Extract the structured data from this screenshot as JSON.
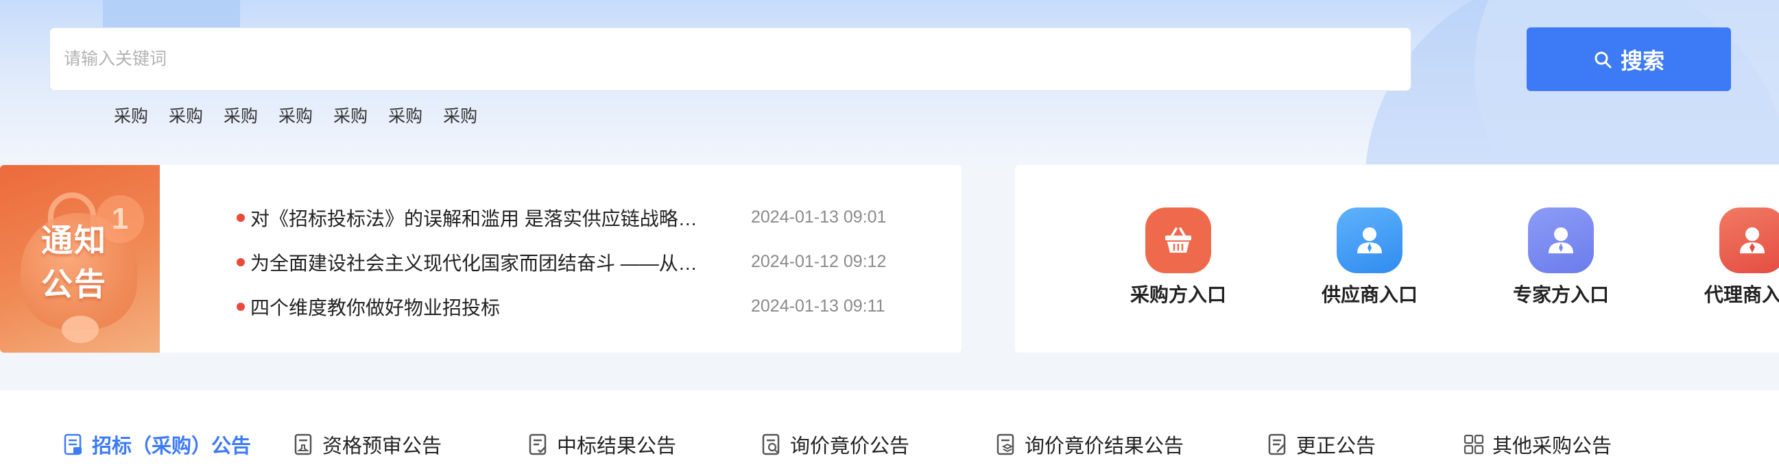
{
  "search": {
    "placeholder": "请输入关键词",
    "button_label": "搜索",
    "hot_words": [
      "采购",
      "采购",
      "采购",
      "采购",
      "采购",
      "采购",
      "采购"
    ]
  },
  "notice": {
    "image_title_line1": "通知",
    "image_title_line2": "公告",
    "badge": "1",
    "items": [
      {
        "title": "对《招标投标法》的误解和滥用 是落实供应链战略…",
        "date": "2024-01-13 09:01"
      },
      {
        "title": "为全面建设社会主义现代化国家而团结奋斗 ——从…",
        "date": "2024-01-12 09:12"
      },
      {
        "title": "四个维度教你做好物业招投标",
        "date": "2024-01-13 09:11"
      }
    ]
  },
  "entries": [
    {
      "label": "采购方入口",
      "icon": "basket-icon",
      "color": "#ef6a4c"
    },
    {
      "label": "供应商入口",
      "icon": "person-icon",
      "color": "#3d9cf3"
    },
    {
      "label": "专家方入口",
      "icon": "person-icon",
      "color": "#7b8cf0"
    },
    {
      "label": "代理商入口",
      "icon": "person-tie-icon",
      "color": "#ec5a4b"
    }
  ],
  "tabs": [
    {
      "label": "招标（采购）公告",
      "icon": "document-icon",
      "active": true
    },
    {
      "label": "资格预审公告",
      "icon": "document-stamp-icon",
      "active": false
    },
    {
      "label": "中标结果公告",
      "icon": "document-check-icon",
      "active": false
    },
    {
      "label": "询价竟价公告",
      "icon": "document-search-icon",
      "active": false
    },
    {
      "label": "询价竟价结果公告",
      "icon": "document-layers-icon",
      "active": false
    },
    {
      "label": "更正公告",
      "icon": "document-edit-icon",
      "active": false
    },
    {
      "label": "其他采购公告",
      "icon": "grid-icon",
      "active": false
    }
  ],
  "colors": {
    "accent": "#3d7af5",
    "news_dot": "#e84b3c"
  }
}
